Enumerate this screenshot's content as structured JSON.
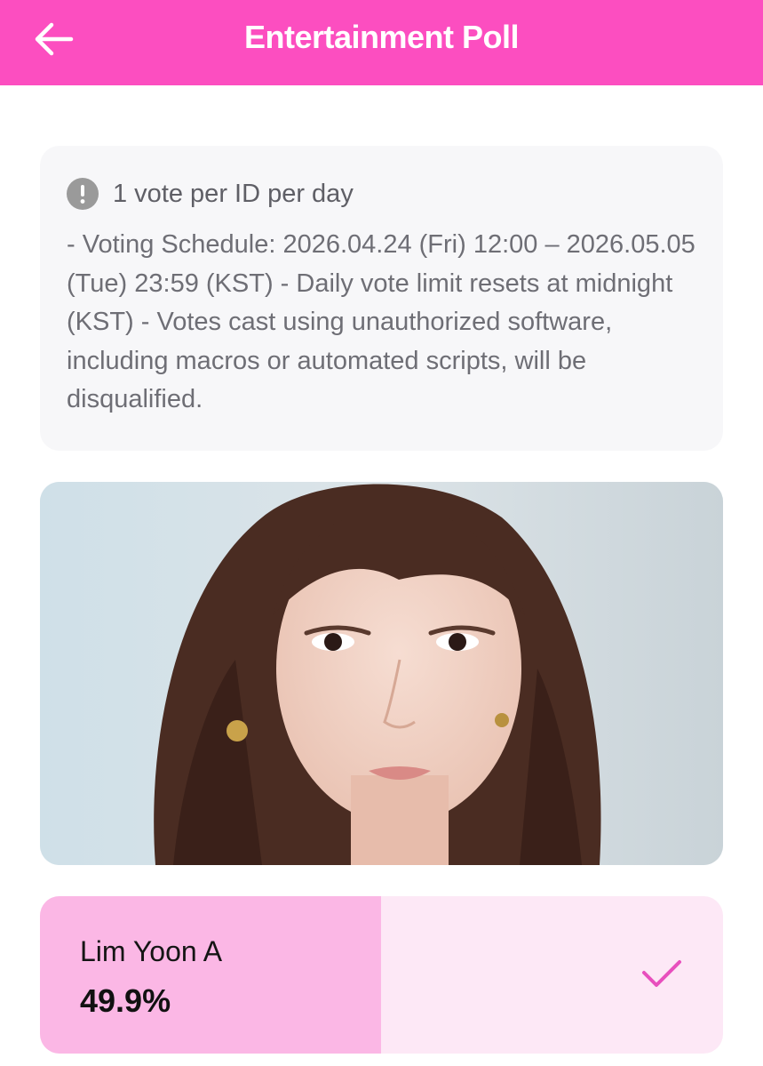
{
  "header": {
    "title": "Entertainment Poll",
    "back_icon": "arrow-left-icon",
    "bg_color": "#fc4ec0"
  },
  "notice": {
    "icon": "alert-circle-icon",
    "title": "1 vote per ID per day",
    "body": "- Voting Schedule: 2026.04.24 (Fri) 12:00 – 2026.05.05 (Tue) 23:59 (KST) - Daily vote limit resets at midnight (KST) - Votes cast using unauthorized software, including macros or automated scripts, will be disqualified."
  },
  "candidate": {
    "name": "Lim Yoon A",
    "percent_label": "49.9%",
    "percent_value": 49.9,
    "selected": true,
    "check_icon": "checkmark-icon",
    "fill_color": "#fbb7e5",
    "track_color": "#fde8f6",
    "accent_color": "#e84fbd"
  }
}
